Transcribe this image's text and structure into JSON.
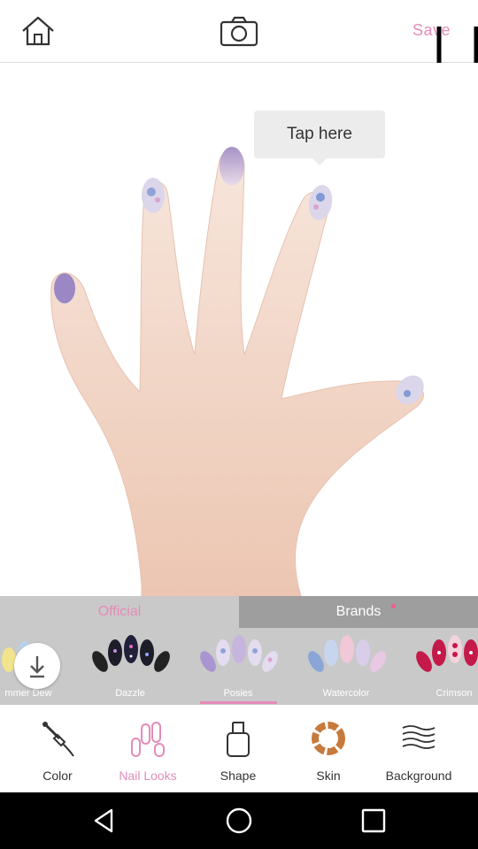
{
  "topbar": {
    "home_icon": "home-icon",
    "camera_icon": "camera-icon",
    "save_label": "Save"
  },
  "canvas": {
    "tooltip": "Tap here"
  },
  "panel": {
    "tab_official": "Official",
    "tab_brands": "Brands",
    "looks": [
      {
        "label": "mmer Dew"
      },
      {
        "label": "Dazzle"
      },
      {
        "label": "Posies"
      },
      {
        "label": "Watercolor"
      },
      {
        "label": "Crimson"
      }
    ],
    "selected_look": "Posies"
  },
  "toolbar": {
    "tools": [
      {
        "label": "Color",
        "icon": "nail-polish-brush-icon"
      },
      {
        "label": "Nail Looks",
        "icon": "nail-looks-icon"
      },
      {
        "label": "Shape",
        "icon": "nail-shape-icon"
      },
      {
        "label": "Skin",
        "icon": "skin-tone-icon"
      },
      {
        "label": "Background",
        "icon": "background-pattern-icon"
      }
    ],
    "active_tool": "Nail Looks"
  },
  "colors": {
    "accent": "#e58bb8",
    "panel_bg": "#c9c9c9",
    "brands_tab_bg": "#9e9e9e",
    "nav_bg": "#000000"
  }
}
